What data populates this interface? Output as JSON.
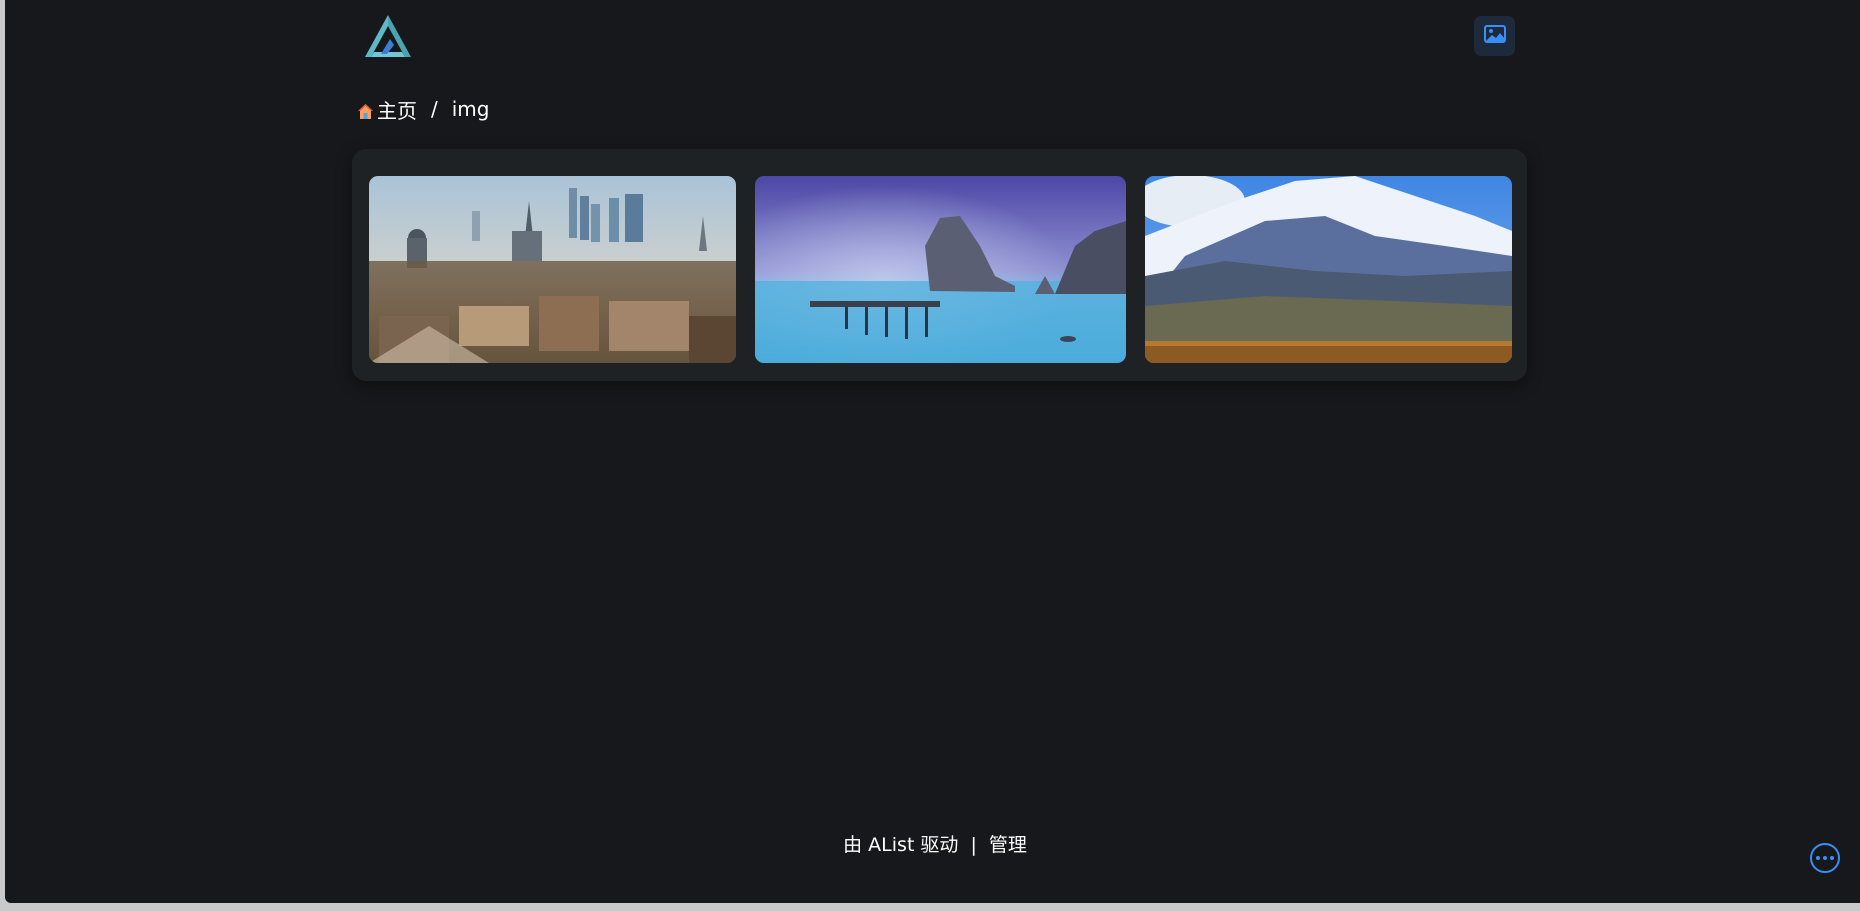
{
  "header": {
    "logo_icon": "alist-logo-icon",
    "layout_toggle_icon": "image-icon"
  },
  "breadcrumb": {
    "home_icon": "home-icon",
    "home_label": "主页",
    "separator": "/",
    "current": "img"
  },
  "gallery": {
    "images": [
      {
        "subject": "city-skyline"
      },
      {
        "subject": "sea-rock-pier"
      },
      {
        "subject": "snow-mountain"
      }
    ]
  },
  "footer": {
    "powered_by": "由 AList 驱动",
    "separator": "|",
    "manage_link": "管理"
  },
  "corner": {
    "more_icon": "more-icon"
  },
  "colors": {
    "background": "#17181b",
    "card": "#1f2225",
    "accent": "#3a8ef7",
    "logo": "#5db9c6"
  }
}
